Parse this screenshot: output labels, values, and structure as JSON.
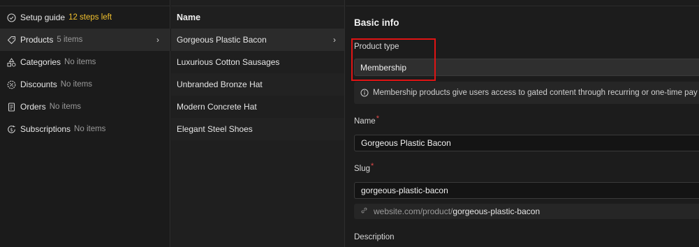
{
  "sidebar": {
    "items": [
      {
        "label": "Setup guide",
        "count": "12 steps left",
        "icon": "check-circle-icon"
      },
      {
        "label": "Products",
        "count": "5 items",
        "icon": "tag-icon",
        "chevron": "›"
      },
      {
        "label": "Categories",
        "count": "No items",
        "icon": "shapes-icon"
      },
      {
        "label": "Discounts",
        "count": "No items",
        "icon": "discount-badge-icon"
      },
      {
        "label": "Orders",
        "count": "No items",
        "icon": "receipt-icon"
      },
      {
        "label": "Subscriptions",
        "count": "No items",
        "icon": "dollar-cycle-icon"
      }
    ]
  },
  "list": {
    "header": "Name",
    "rows": [
      "Gorgeous Plastic Bacon",
      "Luxurious Cotton Sausages",
      "Unbranded Bronze Hat",
      "Modern Concrete Hat",
      "Elegant Steel Shoes"
    ],
    "chevron": "›"
  },
  "detail": {
    "section_title": "Basic info",
    "product_type": {
      "label": "Product type",
      "value": "Membership",
      "info": "Membership products give users access to gated content through recurring or one-time pay"
    },
    "name": {
      "label": "Name",
      "required": "*",
      "value": "Gorgeous Plastic Bacon"
    },
    "slug": {
      "label": "Slug",
      "required": "*",
      "value": "gorgeous-plastic-bacon",
      "url_prefix": "website.com/product/",
      "url_slug": "gorgeous-plastic-bacon"
    },
    "description": {
      "label": "Description"
    }
  },
  "colors": {
    "warning_text": "#f2c12e",
    "required_mark": "#e24a4a",
    "highlight_box": "#e01414"
  }
}
